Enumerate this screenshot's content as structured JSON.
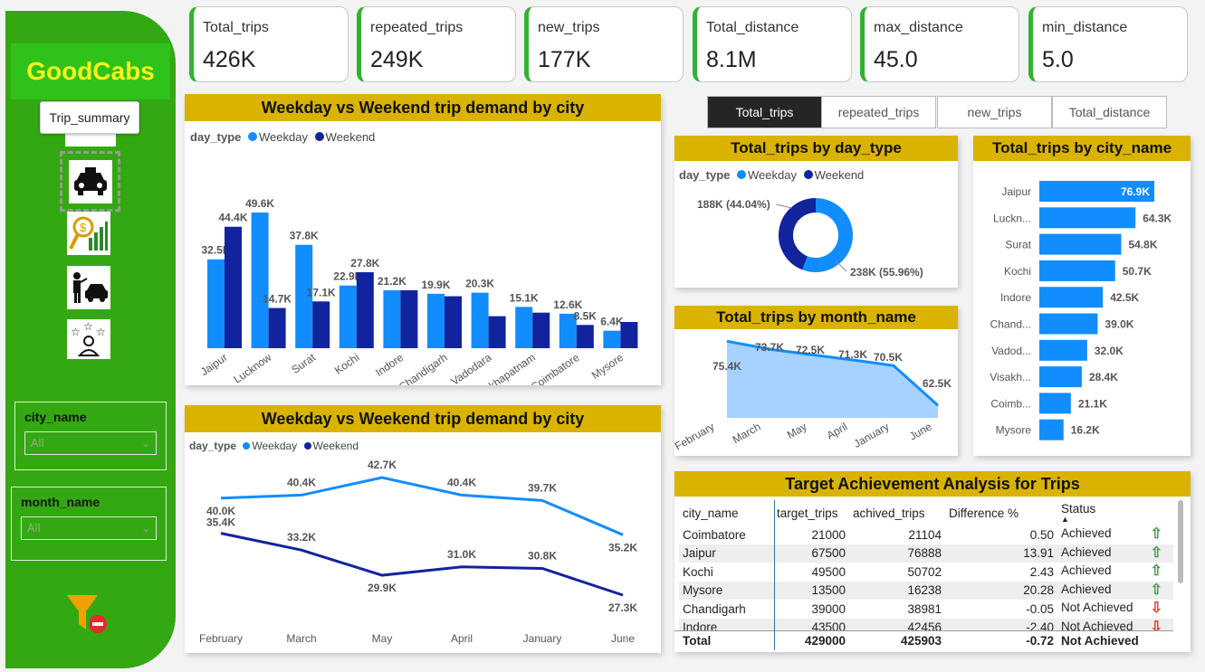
{
  "sidebar": {
    "logo": "GoodCabs",
    "tooltip": "Trip_summary",
    "nav_icons": [
      "taxi-icon",
      "trip-analysis-icon",
      "driver-taxi-icon",
      "rating-icon"
    ],
    "slicers": [
      {
        "label": "city_name",
        "value": "All"
      },
      {
        "label": "month_name",
        "value": "All"
      }
    ],
    "filter_icon": "clear-filter-icon"
  },
  "kpis": [
    {
      "title": "Total_trips",
      "value": "426K"
    },
    {
      "title": "repeated_trips",
      "value": "249K"
    },
    {
      "title": "new_trips",
      "value": "177K"
    },
    {
      "title": "Total_distance",
      "value": "8.1M"
    },
    {
      "title": "max_distance",
      "value": "45.0"
    },
    {
      "title": "min_distance",
      "value": "5.0"
    }
  ],
  "colors": {
    "weekday": "#118dff",
    "weekend": "#12239e",
    "accent": "#34a813",
    "title_bar": "#d9b300"
  },
  "measure_buttons": [
    "Total_trips",
    "repeated_trips",
    "new_trips",
    "Total_distance"
  ],
  "bar_panel": {
    "title": "Weekday vs Weekend trip demand by city",
    "legend_title": "day_type",
    "legend": [
      "Weekday",
      "Weekend"
    ]
  },
  "line_panel": {
    "title": "Weekday vs Weekend trip demand by city",
    "legend_title": "day_type",
    "legend": [
      "Weekday",
      "Weekend"
    ]
  },
  "donut_panel": {
    "title": "Total_trips by day_type",
    "legend_title": "day_type",
    "legend": [
      "Weekday",
      "Weekend"
    ]
  },
  "area_panel": {
    "title": "Total_trips by month_name"
  },
  "hbar_panel": {
    "title": "Total_trips by city_name"
  },
  "table_panel": {
    "title": "Target Achievement Analysis for Trips",
    "columns": [
      "city_name",
      "target_trips",
      "achived_trips",
      "Difference %",
      "Status"
    ],
    "rows": [
      [
        "Coimbatore",
        "21000",
        "21104",
        "0.50",
        "Achieved",
        "up"
      ],
      [
        "Jaipur",
        "67500",
        "76888",
        "13.91",
        "Achieved",
        "up"
      ],
      [
        "Kochi",
        "49500",
        "50702",
        "2.43",
        "Achieved",
        "up"
      ],
      [
        "Mysore",
        "13500",
        "16238",
        "20.28",
        "Achieved",
        "up"
      ],
      [
        "Chandigarh",
        "39000",
        "38981",
        "-0.05",
        "Not Achieved",
        "down"
      ],
      [
        "Indore",
        "43500",
        "42456",
        "-2.40",
        "Not Achieved",
        "down"
      ]
    ],
    "total": [
      "Total",
      "429000",
      "425903",
      "-0.72",
      "Not Achieved"
    ]
  },
  "chart_data": [
    {
      "type": "bar",
      "title": "Weekday vs Weekend trip demand by city",
      "categories": [
        "Jaipur",
        "Lucknow",
        "Surat",
        "Kochi",
        "Indore",
        "Chandigarh",
        "Vadodara",
        "Visakhapatnam",
        "Coimbatore",
        "Mysore"
      ],
      "series": [
        {
          "name": "Weekday",
          "values": [
            32.5,
            49.6,
            37.8,
            22.9,
            21.2,
            19.9,
            20.3,
            15.1,
            12.6,
            6.4
          ],
          "labels": [
            "32.5K",
            "49.6K",
            "37.8K",
            "22.9K",
            "21.2K",
            "19.9K",
            "20.3K",
            "15.1K",
            "12.6K",
            "6.4K"
          ]
        },
        {
          "name": "Weekend",
          "values": [
            44.4,
            14.7,
            17.1,
            27.8,
            21.2,
            19.0,
            11.7,
            13.0,
            8.5,
            9.6
          ],
          "labels": [
            "44.4K",
            "14.7K",
            "17.1K",
            "27.8K",
            "",
            "",
            "",
            "",
            "8.5K",
            ""
          ]
        }
      ]
    },
    {
      "type": "line",
      "title": "Weekday vs Weekend trip demand by city",
      "categories": [
        "February",
        "March",
        "May",
        "April",
        "January",
        "June"
      ],
      "series": [
        {
          "name": "Weekday",
          "values": [
            40.0,
            40.4,
            42.7,
            40.4,
            39.7,
            35.2
          ],
          "labels": [
            "40.0K",
            "40.4K",
            "42.7K",
            "40.4K",
            "39.7K",
            "35.2K"
          ]
        },
        {
          "name": "Weekend",
          "values": [
            35.4,
            33.2,
            29.9,
            31.0,
            30.8,
            27.3
          ],
          "labels": [
            "35.4K",
            "33.2K",
            "29.9K",
            "31.0K",
            "30.8K",
            "27.3K"
          ]
        }
      ]
    },
    {
      "type": "pie",
      "title": "Total_trips by day_type",
      "categories": [
        "Weekday",
        "Weekend"
      ],
      "values": [
        238,
        188
      ],
      "labels": [
        "238K (55.96%)",
        "188K (44.04%)"
      ]
    },
    {
      "type": "area",
      "title": "Total_trips by month_name",
      "categories": [
        "February",
        "March",
        "May",
        "April",
        "January",
        "June"
      ],
      "values": [
        75.4,
        73.7,
        72.5,
        71.3,
        70.5,
        62.5
      ],
      "labels": [
        "75.4K",
        "73.7K",
        "72.5K",
        "71.3K",
        "70.5K",
        "62.5K"
      ]
    },
    {
      "type": "bar",
      "title": "Total_trips by city_name",
      "categories": [
        "Jaipur",
        "Luckn...",
        "Surat",
        "Kochi",
        "Indore",
        "Chand...",
        "Vadod...",
        "Visakh...",
        "Coimb...",
        "Mysore"
      ],
      "values": [
        76.9,
        64.3,
        54.8,
        50.7,
        42.5,
        39.0,
        32.0,
        28.4,
        21.1,
        16.2
      ],
      "labels": [
        "76.9K",
        "64.3K",
        "54.8K",
        "50.7K",
        "42.5K",
        "39.0K",
        "32.0K",
        "28.4K",
        "21.1K",
        "16.2K"
      ]
    }
  ]
}
